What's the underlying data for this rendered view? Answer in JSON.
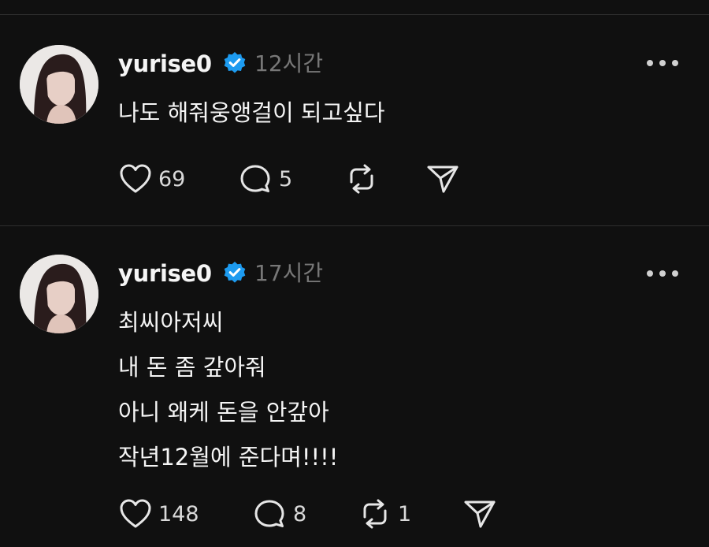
{
  "posts": [
    {
      "username": "yurise0",
      "time": "12시간",
      "lines": [
        "나도 해줘웅앵걸이 되고싶다"
      ],
      "likes": "69",
      "replies": "5",
      "reposts": "",
      "icons": {
        "verified": "verified-badge-icon",
        "more": "more-options-icon",
        "like": "heart-icon",
        "reply": "comment-icon",
        "repost": "repost-icon",
        "share": "send-icon"
      }
    },
    {
      "username": "yurise0",
      "time": "17시간",
      "lines": [
        "최씨아저씨",
        "내 돈 좀 갚아줘",
        "아니 왜케 돈을 안갚아",
        "작년12월에 준다며!!!!"
      ],
      "likes": "148",
      "replies": "8",
      "reposts": "1",
      "icons": {
        "verified": "verified-badge-icon",
        "more": "more-options-icon",
        "like": "heart-icon",
        "reply": "comment-icon",
        "repost": "repost-icon",
        "share": "send-icon"
      }
    }
  ],
  "colors": {
    "background": "#101010",
    "verified": "#1d9bf0",
    "muted": "#777777",
    "divider": "#2e2e2e"
  }
}
